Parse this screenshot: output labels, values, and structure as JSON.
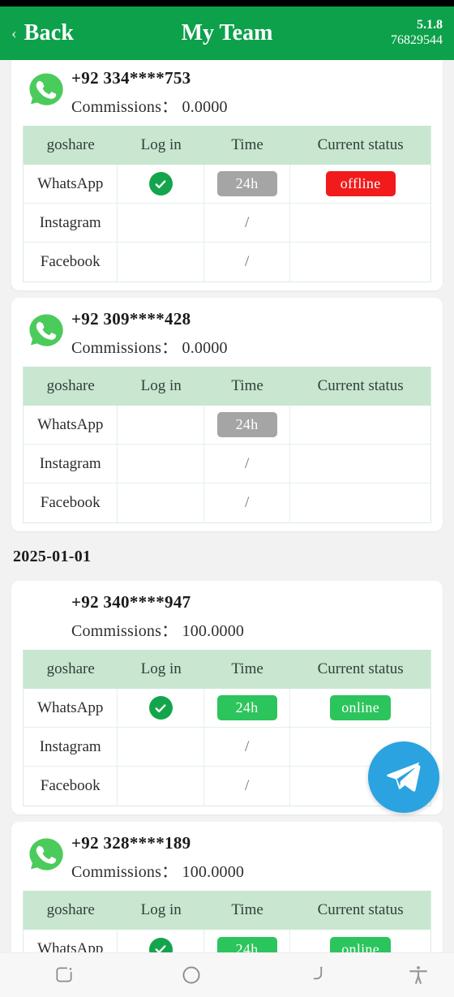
{
  "header": {
    "back_label": "Back",
    "back_icon": "chevron-left-icon",
    "title": "My Team",
    "version": "5.1.8",
    "user_id": "76829544"
  },
  "table_columns": [
    "goshare",
    "Log in",
    "Time",
    "Current status"
  ],
  "colors": {
    "header_green": "#0da14b",
    "table_header": "#c8e6d0",
    "badge_gray": "#a5a5a5",
    "badge_green": "#2cc45c",
    "badge_red": "#f11b1b",
    "check_green": "#13a54b",
    "fab_blue": "#2aa3e0",
    "page_bg": "#f2f2f2"
  },
  "groups": [
    {
      "date": null,
      "cards": [
        {
          "avatar": "whatsapp-icon",
          "has_avatar": true,
          "phone": "+92 334****753",
          "commissions_label": "Commissions：",
          "commissions_value": "0.0000",
          "rows": [
            {
              "platform": "WhatsApp",
              "login": "check",
              "time": "24h",
              "time_style": "gray",
              "status": "offline",
              "status_style": "red"
            },
            {
              "platform": "Instagram",
              "login": "",
              "time": "/",
              "time_style": "plain",
              "status": "",
              "status_style": "none"
            },
            {
              "platform": "Facebook",
              "login": "",
              "time": "/",
              "time_style": "plain",
              "status": "",
              "status_style": "none"
            }
          ]
        },
        {
          "avatar": "whatsapp-icon",
          "has_avatar": true,
          "phone": "+92 309****428",
          "commissions_label": "Commissions：",
          "commissions_value": "0.0000",
          "rows": [
            {
              "platform": "WhatsApp",
              "login": "",
              "time": "24h",
              "time_style": "gray",
              "status": "",
              "status_style": "none"
            },
            {
              "platform": "Instagram",
              "login": "",
              "time": "/",
              "time_style": "plain",
              "status": "",
              "status_style": "none"
            },
            {
              "platform": "Facebook",
              "login": "",
              "time": "/",
              "time_style": "plain",
              "status": "",
              "status_style": "none"
            }
          ]
        }
      ]
    },
    {
      "date": "2025-01-01",
      "cards": [
        {
          "avatar": null,
          "has_avatar": false,
          "phone": "+92 340****947",
          "commissions_label": "Commissions：",
          "commissions_value": "100.0000",
          "rows": [
            {
              "platform": "WhatsApp",
              "login": "check",
              "time": "24h",
              "time_style": "green",
              "status": "online",
              "status_style": "green"
            },
            {
              "platform": "Instagram",
              "login": "",
              "time": "/",
              "time_style": "plain",
              "status": "",
              "status_style": "none"
            },
            {
              "platform": "Facebook",
              "login": "",
              "time": "/",
              "time_style": "plain",
              "status": "",
              "status_style": "none"
            }
          ]
        },
        {
          "avatar": "whatsapp-icon",
          "has_avatar": true,
          "phone": "+92 328****189",
          "commissions_label": "Commissions：",
          "commissions_value": "100.0000",
          "rows": [
            {
              "platform": "WhatsApp",
              "login": "check",
              "time": "24h",
              "time_style": "green",
              "status": "online",
              "status_style": "green"
            }
          ]
        }
      ]
    }
  ],
  "fab": {
    "icon": "telegram-send-icon"
  },
  "navbar": {
    "items": [
      {
        "icon": "recents-icon"
      },
      {
        "icon": "home-circle-icon"
      },
      {
        "icon": "back-arrow-icon"
      },
      {
        "icon": "accessibility-icon"
      }
    ]
  }
}
